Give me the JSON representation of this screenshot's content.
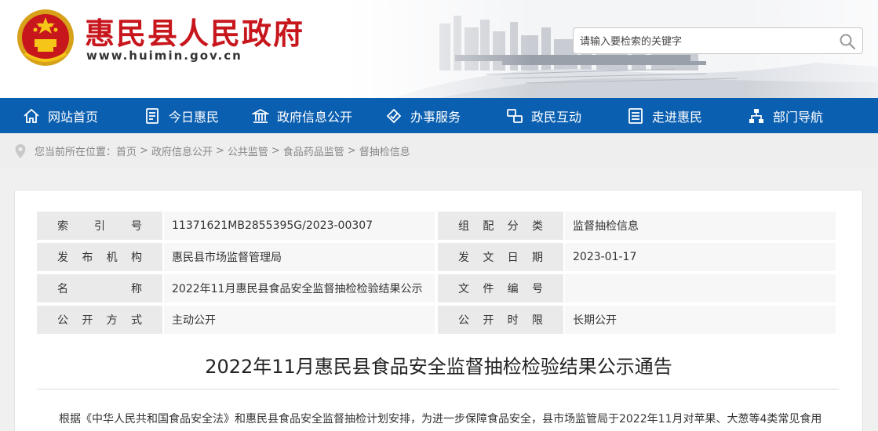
{
  "header": {
    "site_title": "惠民县人民政府",
    "site_url": "www.huimin.gov.cn",
    "search_placeholder": "请输入要检索的关键字"
  },
  "colors": {
    "brand_red": "#c8161d",
    "nav_blue": "#0b5fb0"
  },
  "nav": {
    "items": [
      {
        "label": "网站首页",
        "icon": "home-icon"
      },
      {
        "label": "今日惠民",
        "icon": "document-icon"
      },
      {
        "label": "政府信息公开",
        "icon": "building-icon"
      },
      {
        "label": "办事服务",
        "icon": "handshake-icon"
      },
      {
        "label": "政民互动",
        "icon": "chat-icon"
      },
      {
        "label": "走进惠民",
        "icon": "list-icon"
      },
      {
        "label": "部门导航",
        "icon": "org-chart-icon"
      }
    ]
  },
  "breadcrumb": {
    "prefix": "您当前所在位置：",
    "items": [
      "首页",
      "政府信息公开",
      "公共监管",
      "食品药品监管",
      "督抽检信息"
    ],
    "separator": ">"
  },
  "meta": {
    "rows": [
      {
        "label1": [
          "索",
          "引",
          "号"
        ],
        "value1": "11371621MB2855395G/2023-00307",
        "label2": [
          "组",
          "配",
          "分",
          "类"
        ],
        "value2": "监督抽检信息"
      },
      {
        "label1": [
          "发",
          "布",
          "机",
          "构"
        ],
        "value1": "惠民县市场监督管理局",
        "label2": [
          "发",
          "文",
          "日",
          "期"
        ],
        "value2": "2023-01-17"
      },
      {
        "label1": [
          "名",
          "称"
        ],
        "value1": "2022年11月惠民县食品安全监督抽检检验结果公示",
        "label2": [
          "文",
          "件",
          "编",
          "号"
        ],
        "value2": ""
      },
      {
        "label1": [
          "公",
          "开",
          "方",
          "式"
        ],
        "value1": "主动公开",
        "label2": [
          "公",
          "开",
          "时",
          "限"
        ],
        "value2": "长期公开"
      }
    ]
  },
  "article": {
    "title": "2022年11月惠民县食品安全监督抽检检验结果公示通告",
    "body": "根据《中华人民共和国食品安全法》和惠民县食品安全监督抽检计划安排，为进一步保障食品安全，县市场监管局于2022年11月对苹果、大葱等4类常见食用"
  }
}
